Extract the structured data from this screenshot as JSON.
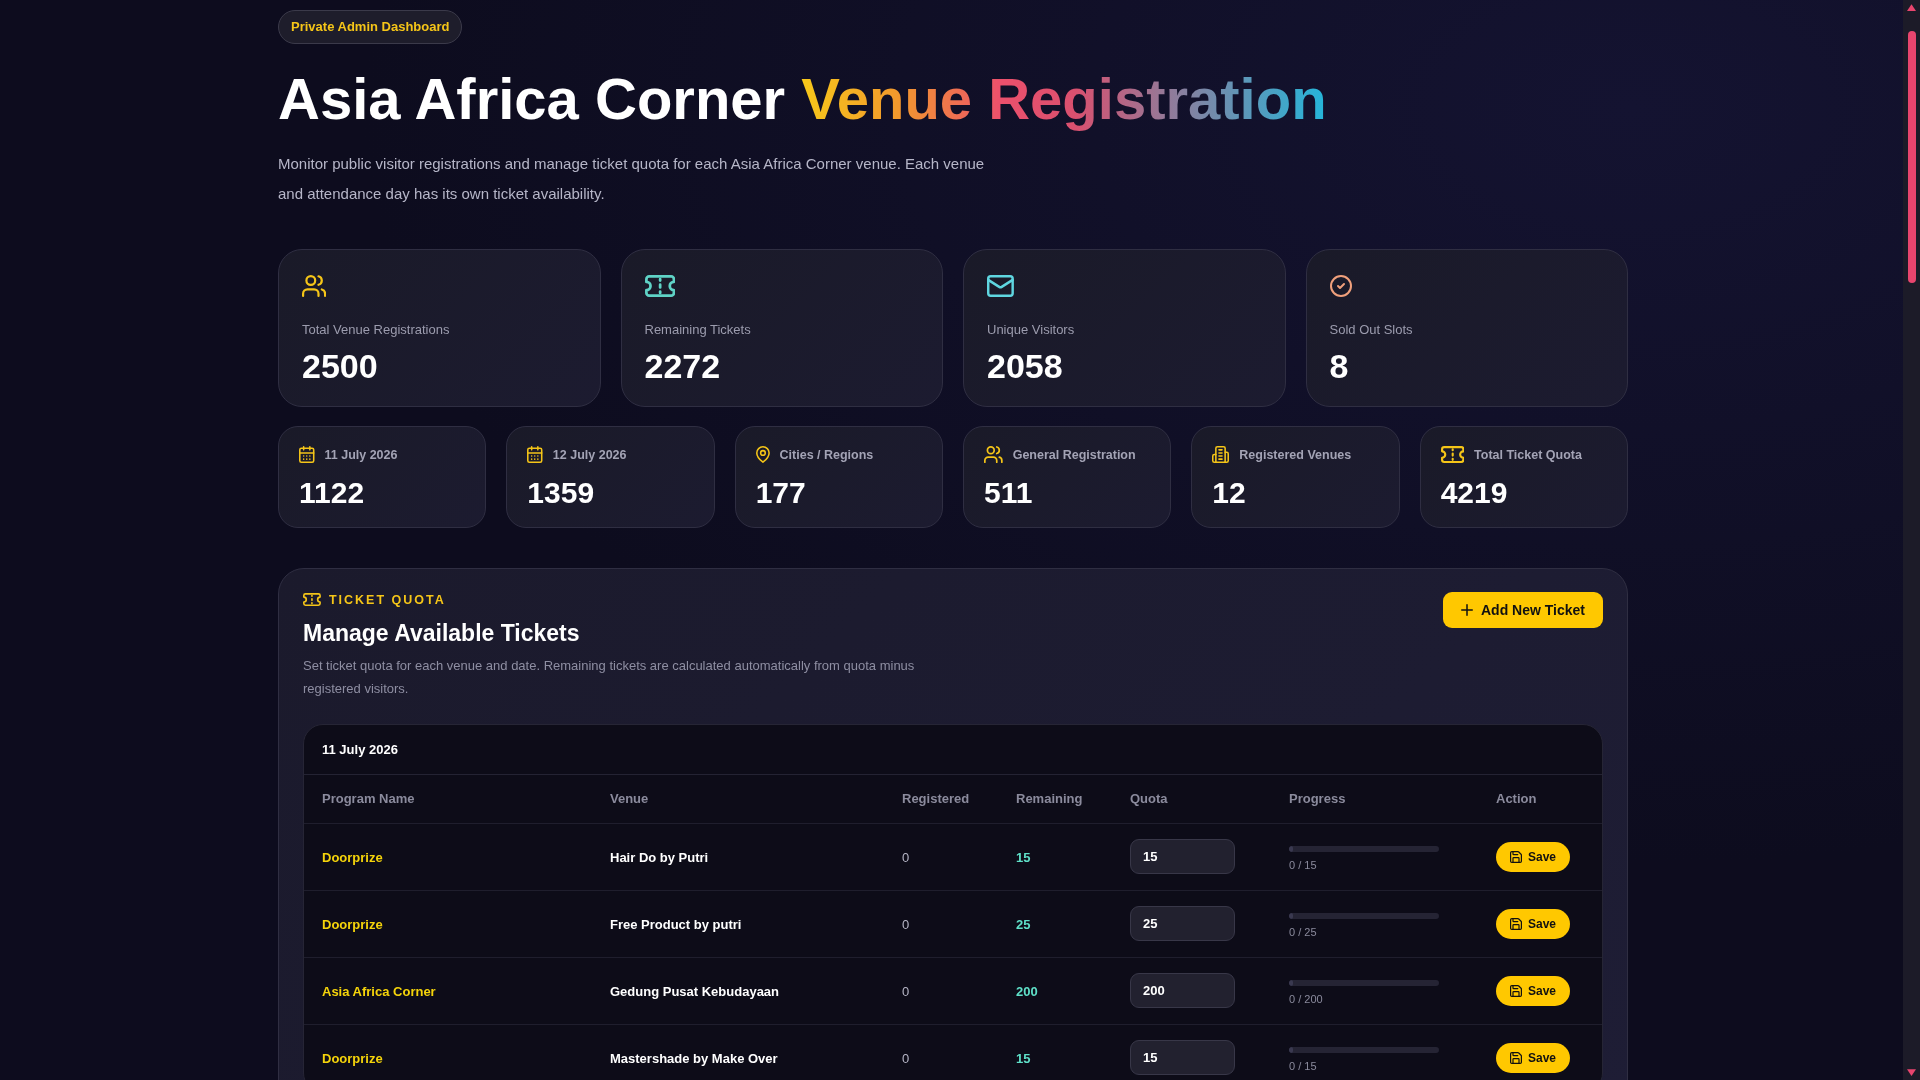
{
  "badge": {
    "label": "Private Admin Dashboard"
  },
  "header": {
    "title": "Asia Africa Corner",
    "title_highlight": "Venue Registration",
    "description": "Monitor public visitor registrations and manage ticket quota for each Asia Africa Corner venue. Each venue and attendance day has its own ticket availability."
  },
  "summary_cards": [
    {
      "kind": "users",
      "color": "#f5c518",
      "label": "Total Venue Registrations",
      "value": "2500"
    },
    {
      "kind": "ticket",
      "color": "#5fd3c6",
      "label": "Remaining Tickets",
      "value": "2272"
    },
    {
      "kind": "mail",
      "color": "#5fd6e0",
      "label": "Unique Visitors",
      "value": "2058"
    },
    {
      "kind": "check",
      "color": "#f0a07c",
      "label": "Sold Out Slots",
      "value": "8"
    }
  ],
  "detail_cards": [
    {
      "kind": "calendar",
      "label": "11 July 2026",
      "value": "1122"
    },
    {
      "kind": "calendar",
      "label": "12 July 2026",
      "value": "1359"
    },
    {
      "kind": "pin",
      "label": "Cities / Regions",
      "value": "177"
    },
    {
      "kind": "users",
      "label": "General Registration",
      "value": "511"
    },
    {
      "kind": "building",
      "label": "Registered Venues",
      "value": "12"
    },
    {
      "kind": "ticket",
      "label": "Total Ticket Quota",
      "value": "4219"
    }
  ],
  "ticket_quota": {
    "eyebrow": "TICKET QUOTA",
    "title": "Manage Available Tickets",
    "description": "Set ticket quota for each venue and date. Remaining tickets are calculated automatically from quota minus registered visitors.",
    "add_button": "Add New Ticket",
    "date_groups": [
      {
        "date": "11 July 2026",
        "columns": [
          "Program Name",
          "Venue",
          "Registered",
          "Remaining",
          "Quota",
          "Progress",
          "Action"
        ],
        "rows": [
          {
            "program": "Doorprize",
            "venue": "Hair Do by Putri",
            "registered": "0",
            "remaining": "15",
            "quota": "15",
            "level": 0,
            "progress": "0 / 15",
            "action": "Save"
          },
          {
            "program": "Doorprize",
            "venue": "Free Product by putri",
            "registered": "0",
            "remaining": "25",
            "quota": "25",
            "level": 0,
            "progress": "0 / 25",
            "action": "Save"
          },
          {
            "program": "Asia Africa Corner",
            "venue": "Gedung Pusat Kebudayaan",
            "registered": "0",
            "remaining": "200",
            "quota": "200",
            "level": 0,
            "progress": "0 / 200",
            "action": "Save"
          },
          {
            "program": "Doorprize",
            "venue": "Mastershade by Make Over",
            "registered": "0",
            "remaining": "15",
            "quota": "15",
            "level": 0,
            "progress": "0 / 15",
            "action": "Save"
          }
        ]
      }
    ]
  }
}
